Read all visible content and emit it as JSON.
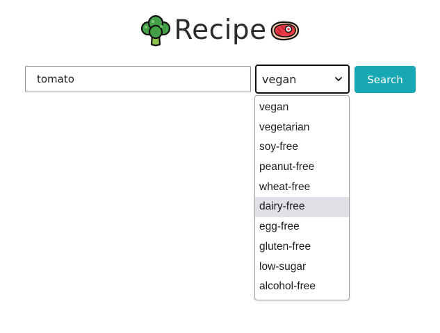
{
  "header": {
    "title": "Recipe",
    "left_icon": "broccoli-icon",
    "right_icon": "meat-steak-icon"
  },
  "search": {
    "value": "tomato"
  },
  "health_select": {
    "selected": "vegan",
    "options": [
      "vegan",
      "vegetarian",
      "soy-free",
      "peanut-free",
      "wheat-free",
      "dairy-free",
      "egg-free",
      "gluten-free",
      "low-sugar",
      "alcohol-free"
    ],
    "hovered_option": "dairy-free"
  },
  "search_button": {
    "label": "Search"
  },
  "colors": {
    "accent": "#17a8b4",
    "hover_background": "#e1e0e6"
  }
}
